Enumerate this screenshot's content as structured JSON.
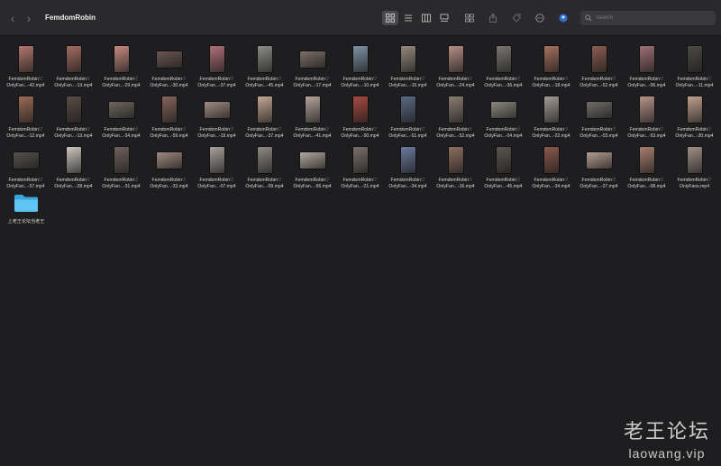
{
  "window": {
    "title": "FemdomRobin",
    "search_placeholder": "Search"
  },
  "toolbar": {
    "back_icon": "chevron-left-icon",
    "forward_icon": "chevron-right-icon",
    "views": [
      "icon-view",
      "list-view",
      "column-view",
      "gallery-view"
    ],
    "active_view": "icon-view"
  },
  "files": [
    {
      "line1": "FemdomRobin♡",
      "line2": "OnlyFan...-42.mp4",
      "shape": "portrait",
      "color": "#b2786c"
    },
    {
      "line1": "FemdomRobin♡",
      "line2": "OnlyFan...-13.mp4",
      "shape": "portrait",
      "color": "#a56c62"
    },
    {
      "line1": "FemdomRobin♡",
      "line2": "OnlyFan...-29.mp4",
      "shape": "portrait",
      "color": "#c58a80"
    },
    {
      "line1": "FemdomRobin♡",
      "line2": "OnlyFan...-30.mp4",
      "shape": "landscape",
      "color": "#6b5752"
    },
    {
      "line1": "FemdomRobin♡",
      "line2": "OnlyFan...-37.mp4",
      "shape": "portrait",
      "color": "#b06f78"
    },
    {
      "line1": "FemdomRobin♡",
      "line2": "OnlyFan...-45.mp4",
      "shape": "portrait",
      "color": "#8d8c86"
    },
    {
      "line1": "FemdomRobin♡",
      "line2": "OnlyFan...-17.mp4",
      "shape": "landscape",
      "color": "#7d6e67"
    },
    {
      "line1": "FemdomRobin♡",
      "line2": "OnlyFan...-10.mp4",
      "shape": "portrait",
      "color": "#7f93a5"
    },
    {
      "line1": "FemdomRobin♡",
      "line2": "OnlyFan...-15.mp4",
      "shape": "portrait",
      "color": "#96897f"
    },
    {
      "line1": "FemdomRobin♡",
      "line2": "OnlyFan...-24.mp4",
      "shape": "portrait",
      "color": "#b58f86"
    },
    {
      "line1": "FemdomRobin♡",
      "line2": "OnlyFan...-36.mp4",
      "shape": "portrait",
      "color": "#7b7772"
    },
    {
      "line1": "FemdomRobin♡",
      "line2": "OnlyFan...-18.mp4",
      "shape": "portrait",
      "color": "#a5725f"
    },
    {
      "line1": "FemdomRobin♡",
      "line2": "OnlyFan...-52.mp4",
      "shape": "portrait",
      "color": "#8a5d52"
    },
    {
      "line1": "FemdomRobin♡",
      "line2": "OnlyFan...-06.mp4",
      "shape": "portrait",
      "color": "#9e6f77"
    },
    {
      "line1": "FemdomRobin♡",
      "line2": "OnlyFan...-11.mp4",
      "shape": "portrait",
      "color": "#4d4a45"
    },
    {
      "line1": "FemdomRobin♡",
      "line2": "OnlyFan...-12.mp4",
      "shape": "portrait",
      "color": "#9a6c57"
    },
    {
      "line1": "FemdomRobin♡",
      "line2": "OnlyFan...-13.mp4",
      "shape": "portrait",
      "color": "#5b4c47"
    },
    {
      "line1": "FemdomRobin♡",
      "line2": "OnlyFan...-34.mp4",
      "shape": "landscape",
      "color": "#6f6760"
    },
    {
      "line1": "FemdomRobin♡",
      "line2": "OnlyFan...-59.mp4",
      "shape": "portrait",
      "color": "#85645c"
    },
    {
      "line1": "FemdomRobin♡",
      "line2": "OnlyFan...-19.mp4",
      "shape": "landscape",
      "color": "#a08c82"
    },
    {
      "line1": "FemdomRobin♡",
      "line2": "OnlyFan...-37.mp4",
      "shape": "portrait",
      "color": "#c4a793"
    },
    {
      "line1": "FemdomRobin♡",
      "line2": "OnlyFan...-41.mp4",
      "shape": "portrait",
      "color": "#b5a39a"
    },
    {
      "line1": "FemdomRobin♡",
      "line2": "OnlyFan...-50.mp4",
      "shape": "portrait",
      "color": "#a74a42"
    },
    {
      "line1": "FemdomRobin♡",
      "line2": "OnlyFan...-51.mp4",
      "shape": "portrait",
      "color": "#5a6b85"
    },
    {
      "line1": "FemdomRobin♡",
      "line2": "OnlyFan...-52.mp4",
      "shape": "portrait",
      "color": "#8c7d73"
    },
    {
      "line1": "FemdomRobin♡",
      "line2": "OnlyFan...-04.mp4",
      "shape": "landscape",
      "color": "#8d887f"
    },
    {
      "line1": "FemdomRobin♡",
      "line2": "OnlyFan...-22.mp4",
      "shape": "portrait",
      "color": "#a49d97"
    },
    {
      "line1": "FemdomRobin♡",
      "line2": "OnlyFan...-03.mp4",
      "shape": "landscape",
      "color": "#706c68"
    },
    {
      "line1": "FemdomRobin♡",
      "line2": "OnlyFan...-53.mp4",
      "shape": "portrait",
      "color": "#b79489"
    },
    {
      "line1": "FemdomRobin♡",
      "line2": "OnlyFan...-30.mp4",
      "shape": "portrait",
      "color": "#c1a18f"
    },
    {
      "line1": "FemdomRobin♡",
      "line2": "OnlyFan...-57.mp4",
      "shape": "landscape",
      "color": "#57524f"
    },
    {
      "line1": "FemdomRobin♡",
      "line2": "OnlyFan...-28.mp4",
      "shape": "portrait",
      "color": "#cfc6bf"
    },
    {
      "line1": "FemdomRobin♡",
      "line2": "OnlyFan...-31.mp4",
      "shape": "portrait",
      "color": "#6f625c"
    },
    {
      "line1": "FemdomRobin♡",
      "line2": "OnlyFan...-33.mp4",
      "shape": "landscape",
      "color": "#9f8b80"
    },
    {
      "line1": "FemdomRobin♡",
      "line2": "OnlyFan...-07.mp4",
      "shape": "portrait",
      "color": "#a7a19b"
    },
    {
      "line1": "FemdomRobin♡",
      "line2": "OnlyFan...-09.mp4",
      "shape": "portrait",
      "color": "#8f8a84"
    },
    {
      "line1": "FemdomRobin♡",
      "line2": "OnlyFan...-56.mp4",
      "shape": "landscape",
      "color": "#b2a79f"
    },
    {
      "line1": "FemdomRobin♡",
      "line2": "OnlyFan...-21.mp4",
      "shape": "portrait",
      "color": "#7a716b"
    },
    {
      "line1": "FemdomRobin♡",
      "line2": "OnlyFan...-34.mp4",
      "shape": "portrait",
      "color": "#6d7aa0"
    },
    {
      "line1": "FemdomRobin♡",
      "line2": "OnlyFan...-16.mp4",
      "shape": "portrait",
      "color": "#8e6f62"
    },
    {
      "line1": "FemdomRobin♡",
      "line2": "OnlyFan...-45.mp4",
      "shape": "portrait",
      "color": "#5c5651"
    },
    {
      "line1": "FemdomRobin♡",
      "line2": "OnlyFan...-34.mp4",
      "shape": "portrait",
      "color": "#8d5a4c"
    },
    {
      "line1": "FemdomRobin♡",
      "line2": "OnlyFan...-27.mp4",
      "shape": "landscape",
      "color": "#b49d91"
    },
    {
      "line1": "FemdomRobin♡",
      "line2": "OnlyFan...-08.mp4",
      "shape": "portrait",
      "color": "#a8806f"
    },
    {
      "line1": "FemdomRobin♡",
      "line2": "OnlyFans.mp4",
      "shape": "portrait",
      "color": "#a19087"
    }
  ],
  "folder": {
    "label": "上老王论坛当老王",
    "color": "#46b5ec"
  },
  "watermark": {
    "cn": "老王论坛",
    "url": "laowang.vip"
  }
}
